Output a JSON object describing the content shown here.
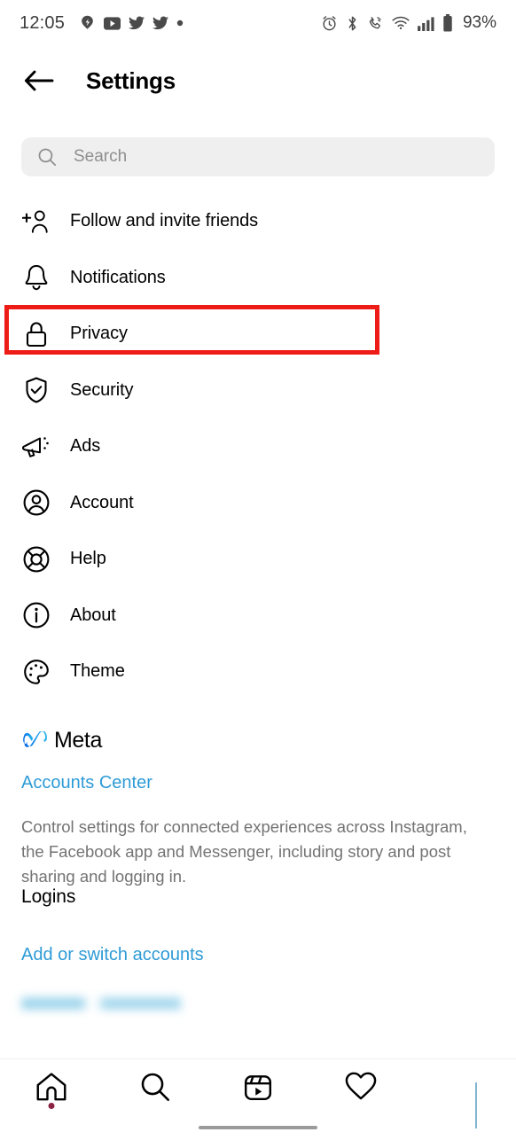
{
  "status_bar": {
    "time": "12:05",
    "battery_percent": "93%",
    "left_icons": [
      "app-notification-icon",
      "youtube-icon",
      "twitter-icon",
      "twitter-icon",
      "dot-icon"
    ],
    "right_icons": [
      "alarm-icon",
      "bluetooth-icon",
      "call-icon",
      "wifi-icon",
      "signal-icon",
      "battery-icon"
    ]
  },
  "header": {
    "title": "Settings",
    "back_icon": "back-arrow-icon"
  },
  "search": {
    "placeholder": "Search",
    "icon": "search-icon"
  },
  "menu": {
    "items": [
      {
        "label": "Follow and invite friends",
        "icon": "person-add-icon",
        "highlighted": false
      },
      {
        "label": "Notifications",
        "icon": "bell-icon",
        "highlighted": false
      },
      {
        "label": "Privacy",
        "icon": "lock-icon",
        "highlighted": true
      },
      {
        "label": "Security",
        "icon": "shield-check-icon",
        "highlighted": false
      },
      {
        "label": "Ads",
        "icon": "megaphone-icon",
        "highlighted": false
      },
      {
        "label": "Account",
        "icon": "person-circle-icon",
        "highlighted": false
      },
      {
        "label": "Help",
        "icon": "lifebuoy-icon",
        "highlighted": false
      },
      {
        "label": "About",
        "icon": "info-circle-icon",
        "highlighted": false
      },
      {
        "label": "Theme",
        "icon": "palette-icon",
        "highlighted": false
      }
    ]
  },
  "annotation": {
    "color": "#ee1c17",
    "target": "Privacy"
  },
  "meta_section": {
    "brand": "Meta",
    "logo_icon": "meta-infinity-icon",
    "link": "Accounts Center",
    "description": "Control settings for connected experiences across Instagram, the Facebook app and Messenger, including story and post sharing and logging in."
  },
  "logins_section": {
    "title": "Logins",
    "link": "Add or switch accounts",
    "redacted_item": ""
  },
  "bottom_nav": {
    "items": [
      {
        "icon": "home-icon",
        "badge": true
      },
      {
        "icon": "search-icon",
        "badge": false
      },
      {
        "icon": "reels-icon",
        "badge": false
      },
      {
        "icon": "heart-icon",
        "badge": false
      },
      {
        "icon": "profile-avatar-icon",
        "badge": false
      }
    ]
  },
  "colors": {
    "link_blue": "#2e9bd6",
    "annotation_red": "#ee1c17",
    "search_bg": "#efefef",
    "muted_text": "#737373",
    "badge_red": "#8a2342"
  }
}
